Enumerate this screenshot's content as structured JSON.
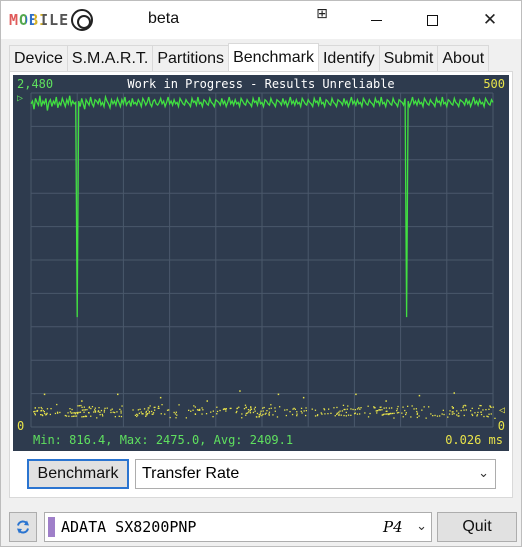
{
  "window": {
    "app_name": "MOBILE",
    "edition": "beta"
  },
  "titlebar": {
    "pin_icon": "⊞",
    "close_glyph": "✕"
  },
  "tabs": [
    {
      "label": "Device",
      "active": false
    },
    {
      "label": "S.M.A.R.T.",
      "active": false
    },
    {
      "label": "Partitions",
      "active": false
    },
    {
      "label": "Benchmark",
      "active": true
    },
    {
      "label": "Identify",
      "active": false
    },
    {
      "label": "Submit",
      "active": false
    },
    {
      "label": "About",
      "active": false
    }
  ],
  "chart": {
    "title": "Work in Progress - Results Unreliable",
    "left_axis_max": "2,480",
    "left_axis_min": "0",
    "right_axis_max": "500",
    "right_axis_min": "0",
    "left_marker": "▷",
    "right_marker": "◁",
    "stats": "Min: 816.4, Max: 2475.0, Avg: 2409.1",
    "access_time": "0.026 ms",
    "colors": {
      "background": "#2e3b4e",
      "grid": "#4a586b",
      "transfer": "#41e041",
      "access": "#e8e34a",
      "title": "#ffffff"
    }
  },
  "chart_data": {
    "type": "line",
    "title": "Work in Progress - Results Unreliable",
    "xlabel": "",
    "ylabel": "",
    "ylim": [
      0,
      2480
    ],
    "y2lim": [
      0,
      500
    ],
    "grid": true,
    "series": [
      {
        "axis": "left",
        "values": [
          2400,
          2420,
          2360,
          2440,
          2410,
          2390,
          2460,
          2380,
          2420,
          2400,
          2440,
          2350,
          2410,
          2430,
          2380,
          2420,
          2400,
          2450,
          2370,
          2410,
          2390,
          2440,
          2410,
          2380,
          2430,
          2400,
          2460,
          2390,
          2420,
          2400,
          2410,
          816,
          2420,
          2380,
          2440,
          2400,
          2360,
          2430,
          2410,
          2390,
          2450,
          2400,
          2380,
          2430,
          2420,
          2400,
          2440,
          2390,
          2410,
          2380,
          2450,
          2420,
          2400,
          2370,
          2430,
          2400,
          2420,
          2390,
          2440,
          2410,
          2380,
          2430,
          2400,
          2450,
          2390,
          2410,
          2420,
          2380,
          2440,
          2400,
          2410,
          2390,
          2430,
          2410,
          2380,
          2440,
          2420,
          2390,
          2410,
          2450,
          2400,
          2380,
          2420,
          2430,
          2400,
          2390,
          2410,
          2440,
          2400,
          2420,
          2380,
          2410,
          2450,
          2400,
          2420,
          2390,
          2430,
          2400,
          2410,
          2380,
          2440,
          2420,
          2400,
          2390,
          2430,
          2410,
          2400,
          2380,
          2440,
          2410,
          2420,
          2390,
          2450,
          2400,
          2410,
          2380,
          2430,
          2420,
          2400,
          2390,
          2440,
          2410,
          2400,
          2380,
          2430,
          2420,
          2410,
          2390,
          2440,
          2400,
          2420,
          2380,
          2410,
          2450,
          2400,
          2420,
          2390,
          2430,
          2400,
          2410,
          2380,
          2440,
          2420,
          2400,
          2390,
          2430,
          2410,
          2400,
          2380,
          2440,
          2410,
          2420,
          2390,
          2450,
          2400,
          2410,
          2380,
          2430,
          2420,
          2400,
          2390,
          2440,
          2410,
          2400,
          2380,
          2430,
          2420,
          2410,
          2390,
          2440,
          2400,
          2420,
          2380,
          2410,
          2450,
          2400,
          2420,
          2390,
          2430,
          2400,
          2410,
          2380,
          2440,
          2420,
          2400,
          2390,
          2430,
          2410,
          2400,
          2380,
          2440,
          2410,
          2420,
          2390,
          2450,
          2400,
          2410,
          2380,
          2430,
          2420,
          2400,
          2390,
          2440,
          2410,
          2400,
          2380,
          2430,
          2420,
          2410,
          2390,
          2440,
          2400,
          2420,
          2380,
          2410,
          2450,
          2400,
          2420,
          2390,
          2430,
          2400,
          2410,
          2380,
          2440,
          2420,
          2400,
          2390,
          2430,
          2410,
          2400,
          2380,
          2440,
          2410,
          2420,
          2390,
          2450,
          2400,
          2410,
          2380,
          2430,
          2420,
          2400,
          2390,
          2440,
          2410,
          2400,
          2380,
          2430,
          2420,
          2410,
          2390,
          2440,
          816,
          2420,
          2380,
          2410,
          2450,
          2400,
          2420,
          2390,
          2430,
          2400,
          2410,
          2380,
          2440,
          2420,
          2400,
          2390,
          2430,
          2410,
          2400,
          2380,
          2440,
          2410,
          2420,
          2390,
          2450,
          2400,
          2410,
          2380,
          2430,
          2420,
          2400,
          2390,
          2440,
          2410,
          2400,
          2380,
          2430,
          2420,
          2410,
          2390,
          2440,
          2400,
          2420,
          2380,
          2410,
          2450,
          2400,
          2420,
          2390,
          2430,
          2400,
          2410,
          2380,
          2440,
          2420,
          2400,
          2390,
          2430,
          2410
        ]
      },
      {
        "axis": "right",
        "marker": "points",
        "values_note": "",
        "typical": 0.026,
        "outliers": [
          50,
          40,
          50,
          45,
          40,
          55,
          50,
          45,
          50,
          40,
          48,
          52
        ]
      }
    ]
  },
  "controls": {
    "benchmark_label": "Benchmark",
    "mode_selected": "Transfer Rate",
    "quit_label": "Quit",
    "drive_name": "ADATA SX8200PNP",
    "drive_port": "P4",
    "drive_color": "#9f7fc9"
  }
}
